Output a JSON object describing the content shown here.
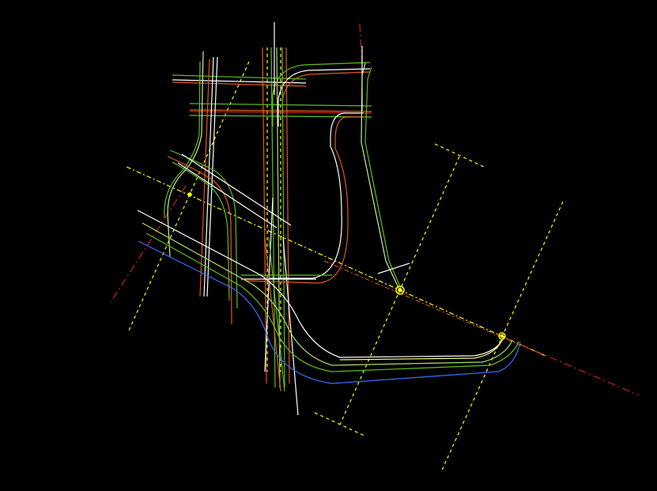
{
  "colors": {
    "background": "#000000",
    "white": "#ffffff",
    "green": "#5fbf1a",
    "lightgreen": "#a8e070",
    "orange": "#e05a20",
    "red": "#c81e1e",
    "yellow": "#ffff00",
    "blue": "#3b6cff",
    "palegreen": "#cfe8a0"
  },
  "layers": [
    {
      "name": "centerline",
      "color": "red"
    },
    {
      "name": "road-edge",
      "color": "white"
    },
    {
      "name": "lane-line",
      "color": "green"
    },
    {
      "name": "curb",
      "color": "orange"
    },
    {
      "name": "section-line",
      "color": "yellow"
    },
    {
      "name": "outer-edge",
      "color": "blue"
    }
  ],
  "markers": [
    {
      "name": "station-point-1",
      "color": "yellow"
    },
    {
      "name": "station-point-2",
      "color": "yellow"
    },
    {
      "name": "station-point-3",
      "color": "yellow"
    }
  ]
}
